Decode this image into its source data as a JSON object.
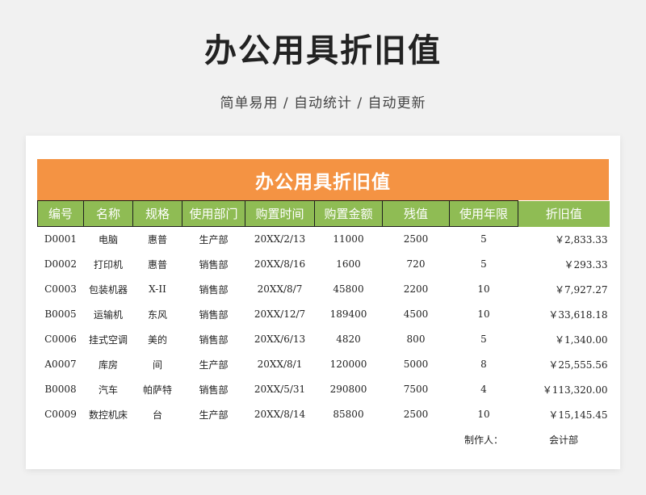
{
  "page": {
    "title": "办公用具折旧值",
    "subtitle": "简单易用 / 自动统计 / 自动更新"
  },
  "sheet": {
    "banner_title": "办公用具折旧值",
    "headers": [
      "编号",
      "名称",
      "规格",
      "使用部门",
      "购置时间",
      "购置金额",
      "残值",
      "使用年限",
      "折旧值"
    ],
    "rows": [
      [
        "D0001",
        "电脑",
        "惠普",
        "生产部",
        "20XX/2/13",
        "11000",
        "2500",
        "5",
        "￥2,833.33"
      ],
      [
        "D0002",
        "打印机",
        "惠普",
        "销售部",
        "20XX/8/16",
        "1600",
        "720",
        "5",
        "￥293.33"
      ],
      [
        "C0003",
        "包装机器",
        "X-II",
        "销售部",
        "20XX/8/7",
        "45800",
        "2200",
        "10",
        "￥7,927.27"
      ],
      [
        "B0005",
        "运输机",
        "东风",
        "销售部",
        "20XX/12/7",
        "189400",
        "4500",
        "10",
        "￥33,618.18"
      ],
      [
        "C0006",
        "挂式空调",
        "美的",
        "销售部",
        "20XX/6/13",
        "4820",
        "800",
        "5",
        "￥1,340.00"
      ],
      [
        "A0007",
        "库房",
        "间",
        "生产部",
        "20XX/8/1",
        "120000",
        "5000",
        "8",
        "￥25,555.56"
      ],
      [
        "B0008",
        "汽车",
        "帕萨特",
        "销售部",
        "20XX/5/31",
        "290800",
        "7500",
        "4",
        "￥113,320.00"
      ],
      [
        "C0009",
        "数控机床",
        "台",
        "生产部",
        "20XX/8/14",
        "85800",
        "2500",
        "10",
        "￥15,145.45"
      ]
    ],
    "footer": {
      "maker_label": "制作人：",
      "maker_value": "会计部"
    }
  },
  "colors": {
    "banner": "#f49343",
    "header": "#8fbc54"
  }
}
